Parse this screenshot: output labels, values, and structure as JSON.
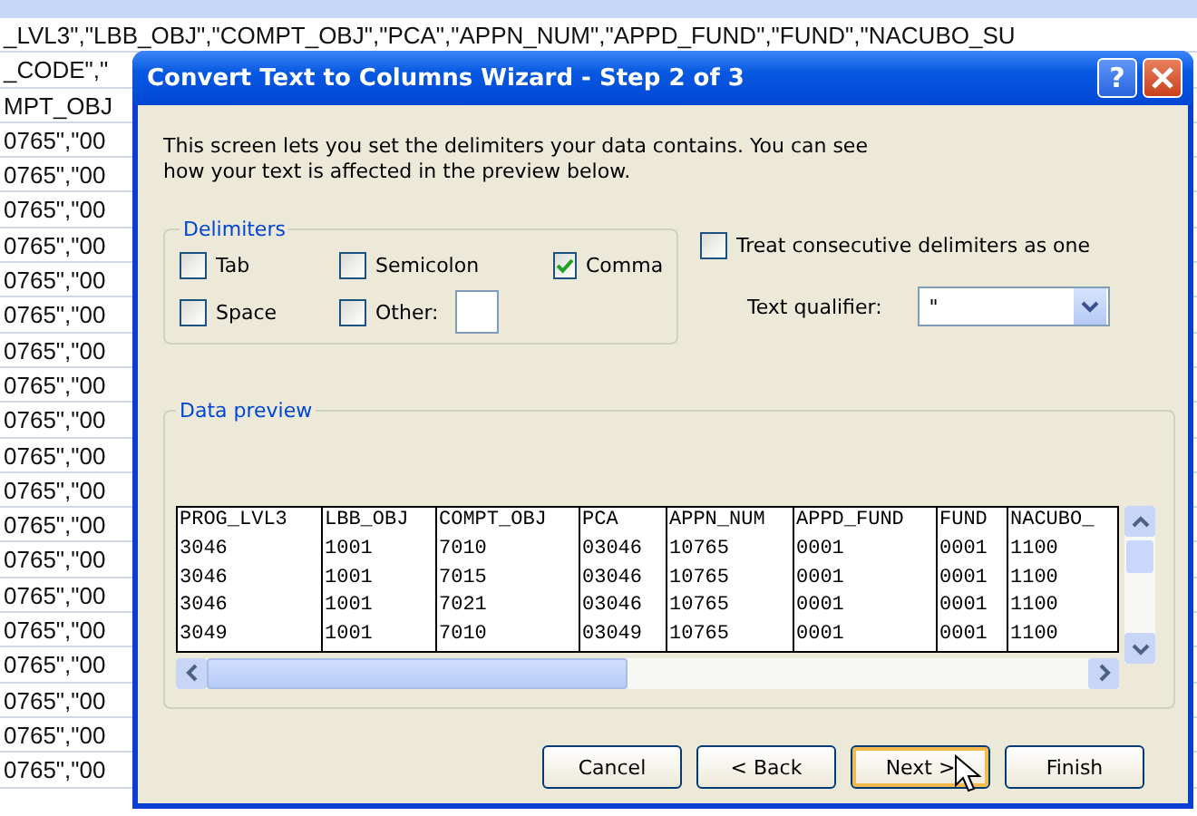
{
  "sheet": {
    "rows": [
      "_LVL3\",\"LBB_OBJ\",\"COMPT_OBJ\",\"PCA\",\"APPN_NUM\",\"APPD_FUND\",\"FUND\",\"NACUBO_SU",
      "_CODE\",\"",
      "MPT_OBJ",
      "0765\",\"00",
      "0765\",\"00",
      "0765\",\"00",
      "0765\",\"00",
      "0765\",\"00",
      "0765\",\"00",
      "0765\",\"00",
      "0765\",\"00",
      "0765\",\"00",
      "0765\",\"00",
      "0765\",\"00",
      "0765\",\"00",
      "0765\",\"00",
      "0765\",\"00",
      "0765\",\"00",
      "0765\",\"00",
      "0765\",\"00",
      "0765\",\"00",
      "0765\",\"00"
    ]
  },
  "dialog": {
    "title": "Convert Text to Columns Wizard - Step 2 of 3",
    "help": "?",
    "description": "This screen lets you set the delimiters your data contains.  You can see how your text is affected in the preview below.",
    "delimiters": {
      "label": "Delimiters",
      "options": [
        {
          "label": "Tab",
          "checked": false
        },
        {
          "label": "Semicolon",
          "checked": false
        },
        {
          "label": "Comma",
          "checked": true
        },
        {
          "label": "Space",
          "checked": false
        },
        {
          "label": "Other:",
          "checked": false
        }
      ]
    },
    "treat_consecutive": {
      "label": "Treat consecutive delimiters as one",
      "checked": false
    },
    "text_qualifier": {
      "label": "Text qualifier:",
      "value": "\""
    },
    "preview": {
      "label": "Data preview",
      "columns": [
        "PROG_LVL3",
        "LBB_OBJ",
        "COMPT_OBJ",
        "PCA",
        "APPN_NUM",
        "APPD_FUND",
        "FUND",
        "NACUBO_"
      ],
      "rows": [
        [
          "3046",
          "1001",
          "7010",
          "03046",
          "10765",
          "0001",
          "0001",
          "1100"
        ],
        [
          "3046",
          "1001",
          "7015",
          "03046",
          "10765",
          "0001",
          "0001",
          "1100"
        ],
        [
          "3046",
          "1001",
          "7021",
          "03046",
          "10765",
          "0001",
          "0001",
          "1100"
        ],
        [
          "3049",
          "1001",
          "7010",
          "03049",
          "10765",
          "0001",
          "0001",
          "1100"
        ]
      ]
    },
    "buttons": [
      {
        "label": "Cancel",
        "selected": false
      },
      {
        "label": "< Back",
        "selected": false
      },
      {
        "label": "Next >",
        "selected": true
      },
      {
        "label": "Finish",
        "selected": false
      }
    ]
  }
}
